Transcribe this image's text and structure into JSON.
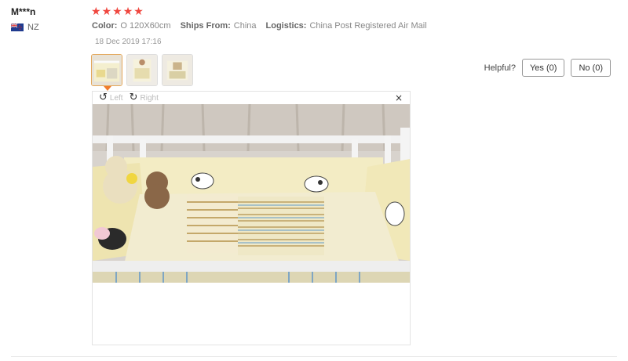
{
  "review": {
    "user_name": "M***n",
    "country": "NZ",
    "rating": 5,
    "stars": [
      "★",
      "★",
      "★",
      "★",
      "★"
    ],
    "attributes": [
      {
        "label": "Color:",
        "value": "O 120X60cm"
      },
      {
        "label": "Ships From:",
        "value": "China"
      },
      {
        "label": "Logistics:",
        "value": "China Post Registered Air Mail"
      }
    ],
    "date": "18 Dec 2019 17:16"
  },
  "helpful": {
    "label": "Helpful?",
    "yes_label": "Yes (0)",
    "no_label": "No (0)"
  },
  "viewer": {
    "rotate_left_label": "Left",
    "rotate_right_label": "Right",
    "rotate_left_icon": "↺",
    "rotate_right_icon": "↻",
    "close_icon": "×",
    "thumbnail_count": 3,
    "active_thumbnail": 0
  },
  "colors": {
    "star": "#f0473f",
    "active_thumb_border": "#e4a75a",
    "pointer": "#f07c2d"
  }
}
